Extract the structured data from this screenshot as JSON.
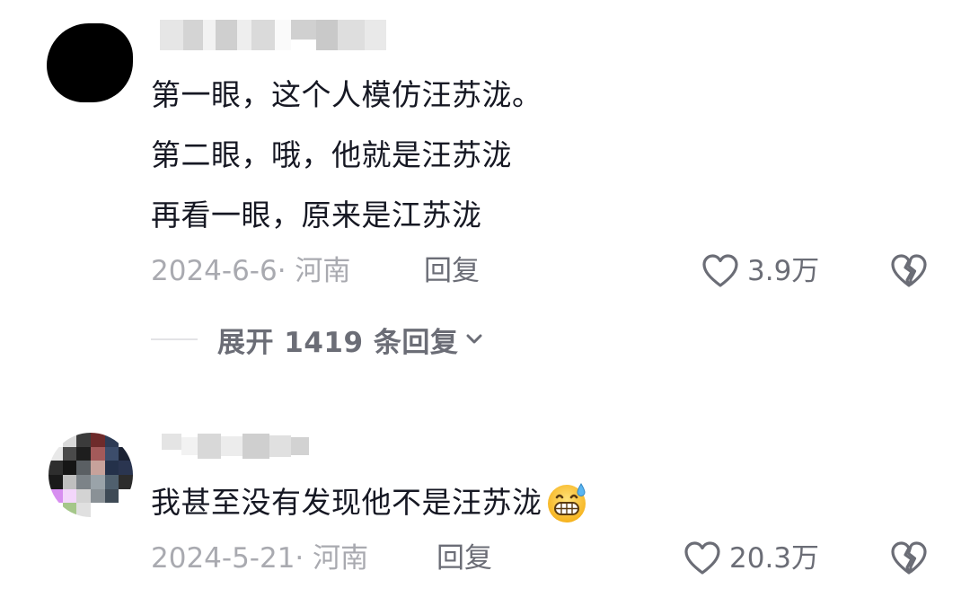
{
  "comments": [
    {
      "lines": [
        "第一眼，这个人模仿汪苏泷。",
        "第二眼，哦，他就是汪苏泷",
        "再看一眼，原来是江苏泷"
      ],
      "date_location": "2024-6-6· 河南",
      "reply_label": "回复",
      "likes": "3.9万",
      "expand_label": "展开 1419 条回复"
    },
    {
      "text": "我甚至没有发现他不是汪苏泷",
      "date_location": "2024-5-21· 河南",
      "reply_label": "回复",
      "likes": "20.3万"
    }
  ],
  "icons": {
    "like": "heart-outline-icon",
    "dislike": "broken-heart-icon",
    "expand": "chevron-down-icon",
    "emoji": "grinning-sweat-emoji-icon"
  },
  "colors": {
    "text": "#161823",
    "meta": "#a9aab0",
    "secondary": "#6b6d76"
  }
}
